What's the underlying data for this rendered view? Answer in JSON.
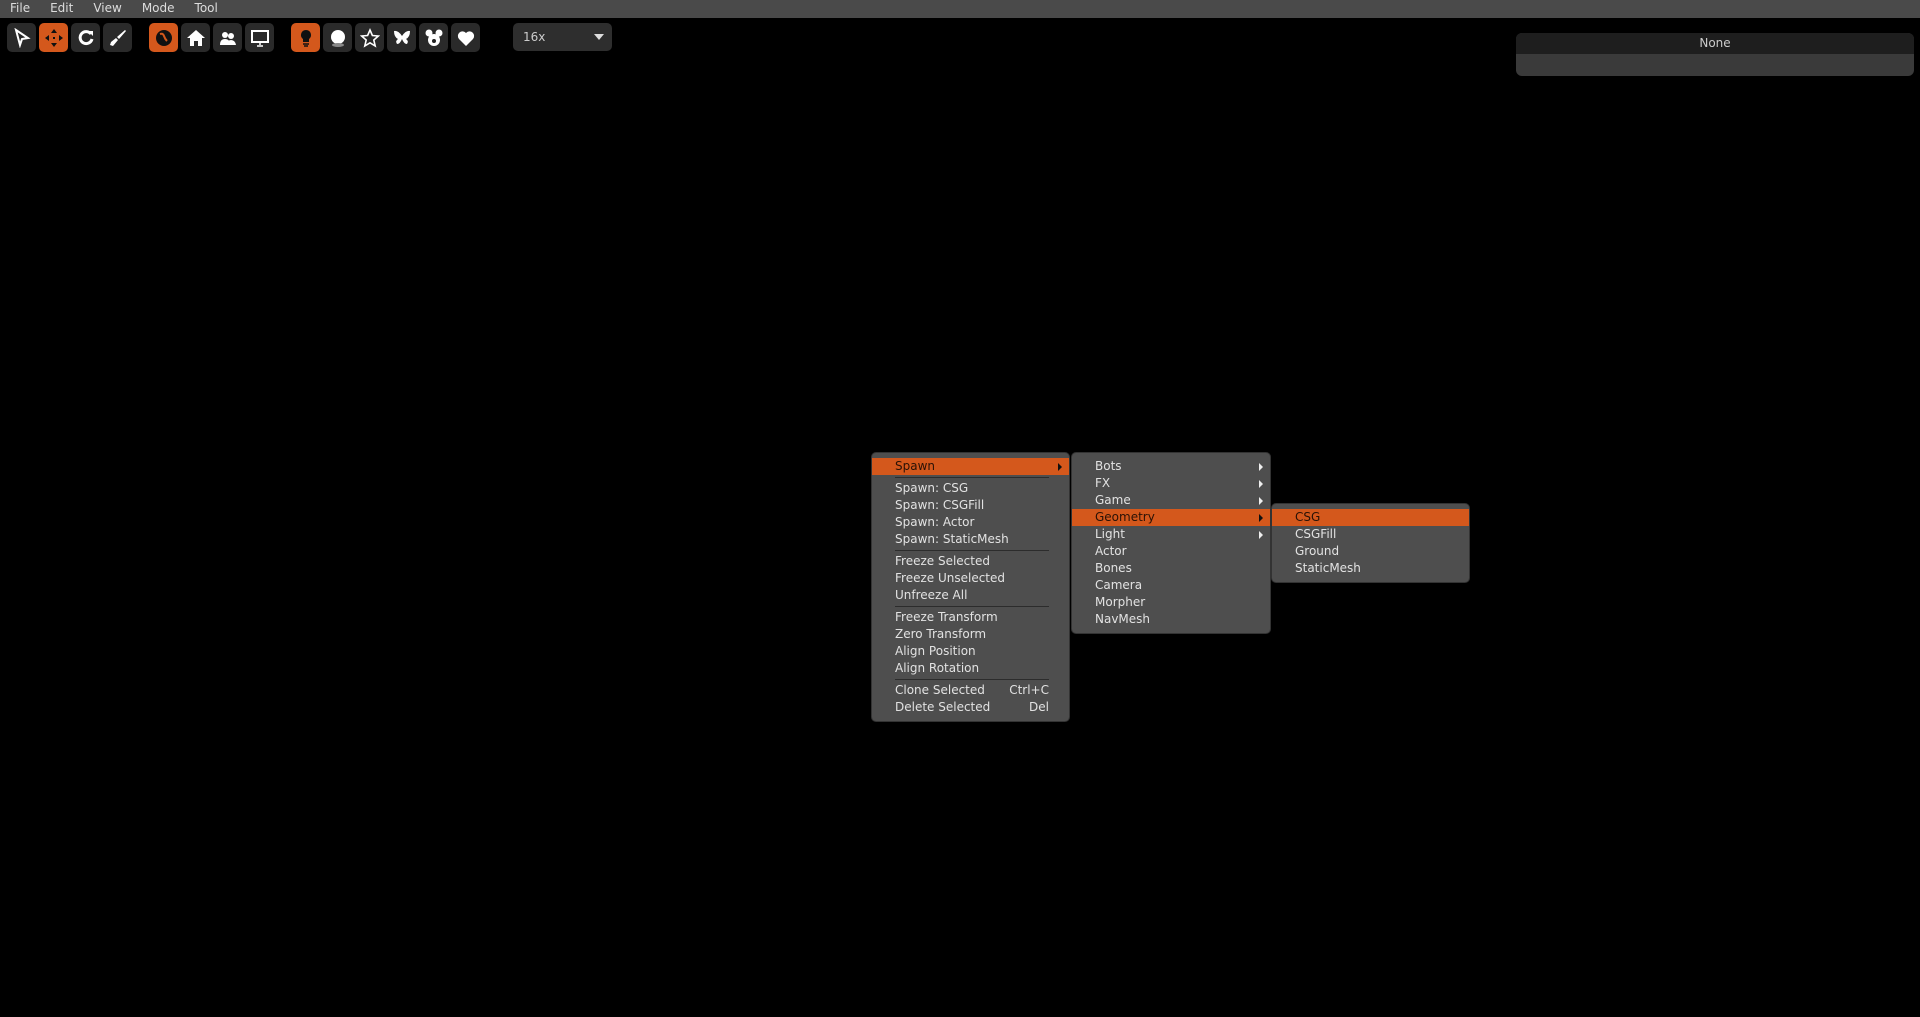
{
  "menubar": [
    "File",
    "Edit",
    "View",
    "Mode",
    "Tool"
  ],
  "toolbar": {
    "zoom_value": "16x"
  },
  "panel": {
    "title": "None"
  },
  "context_menu": {
    "spawn": "Spawn",
    "items": [
      "Spawn: CSG",
      "Spawn: CSGFill",
      "Spawn: Actor",
      "Spawn: StaticMesh",
      "Freeze Selected",
      "Freeze Unselected",
      "Unfreeze All",
      "Freeze Transform",
      "Zero Transform",
      "Align Position",
      "Align Rotation",
      "Clone Selected",
      "Delete Selected"
    ],
    "shortcuts": {
      "clone": "Ctrl+C",
      "delete": "Del"
    }
  },
  "spawn_menu": [
    "Bots",
    "FX",
    "Game",
    "Geometry",
    "Light",
    "Actor",
    "Bones",
    "Camera",
    "Morpher",
    "NavMesh"
  ],
  "geometry_menu": [
    "CSG",
    "CSGFill",
    "Ground",
    "StaticMesh"
  ],
  "colors": {
    "accent": "#d4581c",
    "menu_bg": "#4e4e4e"
  }
}
